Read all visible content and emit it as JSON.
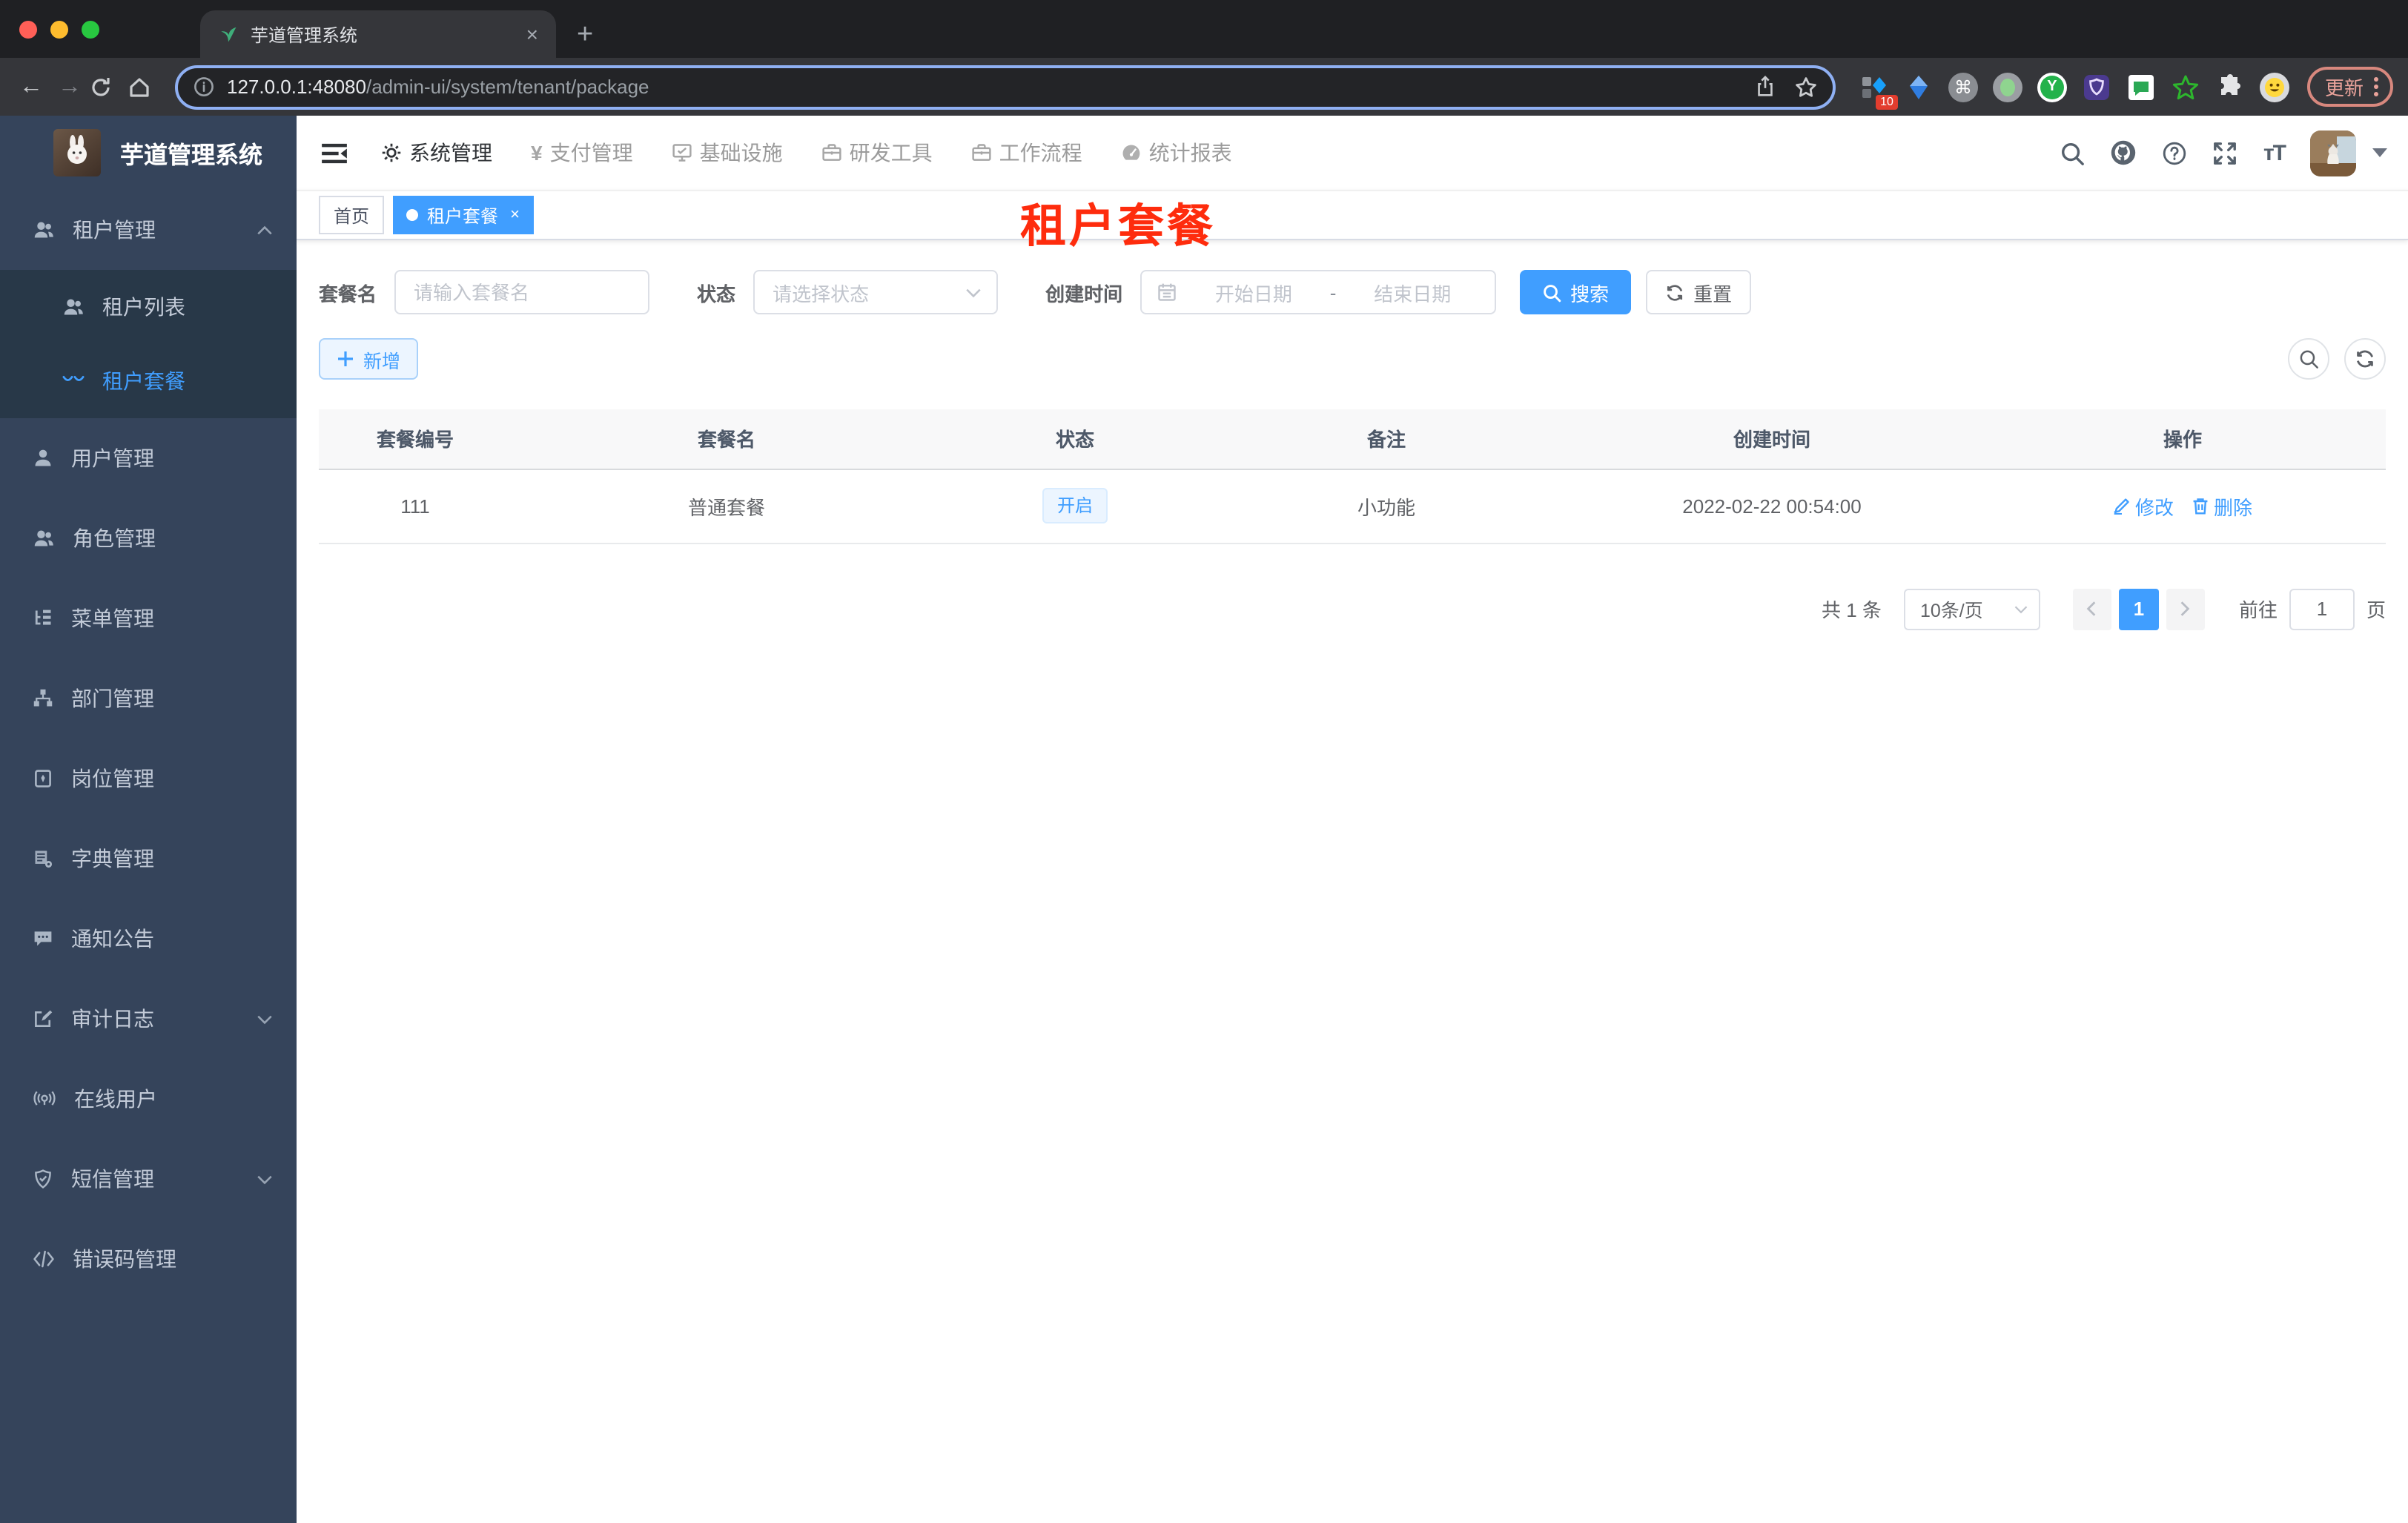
{
  "colors": {
    "accent": "#409eff",
    "sidebar_bg": "#35445b",
    "sidebar_submenu_bg": "#283848",
    "annotation_red": "#fe2c0d",
    "status_tag_bg": "#ecf5ff",
    "update_chip": "#e9a29a"
  },
  "browser": {
    "tab_title": "芋道管理系统",
    "tab_close": "×",
    "new_tab": "+",
    "back": "←",
    "forward": "→",
    "url_host": "127.0.0.1:48080",
    "url_path": "/admin-ui/system/tenant/package",
    "extension_badge": "10",
    "command_glyph": "⌘",
    "update_label": "更新",
    "extension_icons": [
      "squares-diamond-icon",
      "blue-kite-icon",
      "command-icon",
      "green-dot-icon",
      "y-circle-icon",
      "purple-shield-icon",
      "chat-square-icon",
      "green-star-icon",
      "puzzle-icon",
      "smiley-icon"
    ]
  },
  "sidebar": {
    "logo_title": "芋道管理系统",
    "items": [
      {
        "label": "租户管理"
      },
      {
        "label": "租户列表"
      },
      {
        "label": "租户套餐"
      },
      {
        "label": "用户管理"
      },
      {
        "label": "角色管理"
      },
      {
        "label": "菜单管理"
      },
      {
        "label": "部门管理"
      },
      {
        "label": "岗位管理"
      },
      {
        "label": "字典管理"
      },
      {
        "label": "通知公告"
      },
      {
        "label": "审计日志"
      },
      {
        "label": "在线用户"
      },
      {
        "label": "短信管理"
      },
      {
        "label": "错误码管理"
      }
    ]
  },
  "topnav": {
    "items": [
      {
        "label": "系统管理"
      },
      {
        "label": "支付管理"
      },
      {
        "label": "基础设施"
      },
      {
        "label": "研发工具"
      },
      {
        "label": "工作流程"
      },
      {
        "label": "统计报表"
      }
    ],
    "fontsize_glyph": "тT"
  },
  "tags": {
    "home": "首页",
    "active": "租户套餐",
    "close": "×"
  },
  "annotation": "租户套餐",
  "filter": {
    "name_label": "套餐名",
    "name_placeholder": "请输入套餐名",
    "status_label": "状态",
    "status_placeholder": "请选择状态",
    "date_label": "创建时间",
    "date_start": "开始日期",
    "date_sep": "-",
    "date_end": "结束日期",
    "search": "搜索",
    "reset": "重置"
  },
  "toolbar": {
    "add": "新增"
  },
  "table": {
    "headers": [
      "套餐编号",
      "套餐名",
      "状态",
      "备注",
      "创建时间",
      "操作"
    ],
    "row": {
      "id": "111",
      "name": "普通套餐",
      "status": "开启",
      "remark": "小功能",
      "created": "2022-02-22 00:54:00"
    },
    "edit": "修改",
    "delete": "删除"
  },
  "pagination": {
    "total": "共 1 条",
    "page_size": "10条/页",
    "page": "1",
    "goto": "前往",
    "goto_value": "1",
    "unit": "页"
  }
}
